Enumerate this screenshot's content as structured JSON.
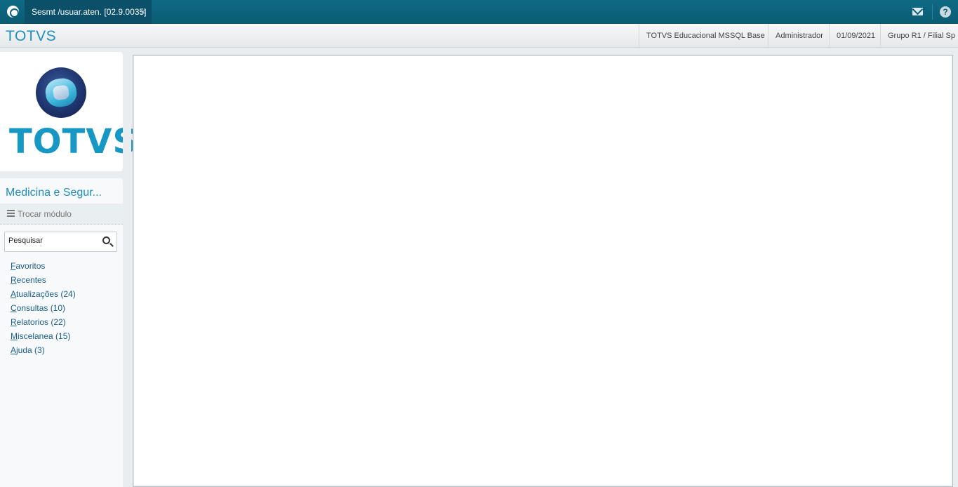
{
  "window": {
    "tab_title": "Sesmt /usuar.aten. [02.9.0035]",
    "tab_close_glyph": "×",
    "help_glyph": "?",
    "icons": [
      "app-logo-icon",
      "mail-icon",
      "help-icon",
      "close-icon"
    ]
  },
  "header": {
    "brand": "TOTVS",
    "environment": "TOTVS Educacional MSSQL Base",
    "user": "Administrador",
    "date": "01/09/2021",
    "branch": "Grupo R1 / Filial Sp"
  },
  "logo": {
    "text": "TOTVS"
  },
  "sidebar": {
    "module_title": "Medicina e Segur...",
    "switch_module_label": "Trocar módulo",
    "search": {
      "placeholder": "Pesquisar",
      "value": ""
    },
    "items": [
      {
        "label": "Favoritos"
      },
      {
        "label": "Recentes"
      },
      {
        "label": "Atualizações (24)"
      },
      {
        "label": "Consultas (10)"
      },
      {
        "label": "Relatorios (22)"
      },
      {
        "label": "Miscelanea (15)"
      },
      {
        "label": "Ajuda (3)"
      }
    ]
  },
  "colors": {
    "topbar": "#0c637d",
    "brand": "#1d8fc1",
    "link": "#1a5f8a"
  }
}
